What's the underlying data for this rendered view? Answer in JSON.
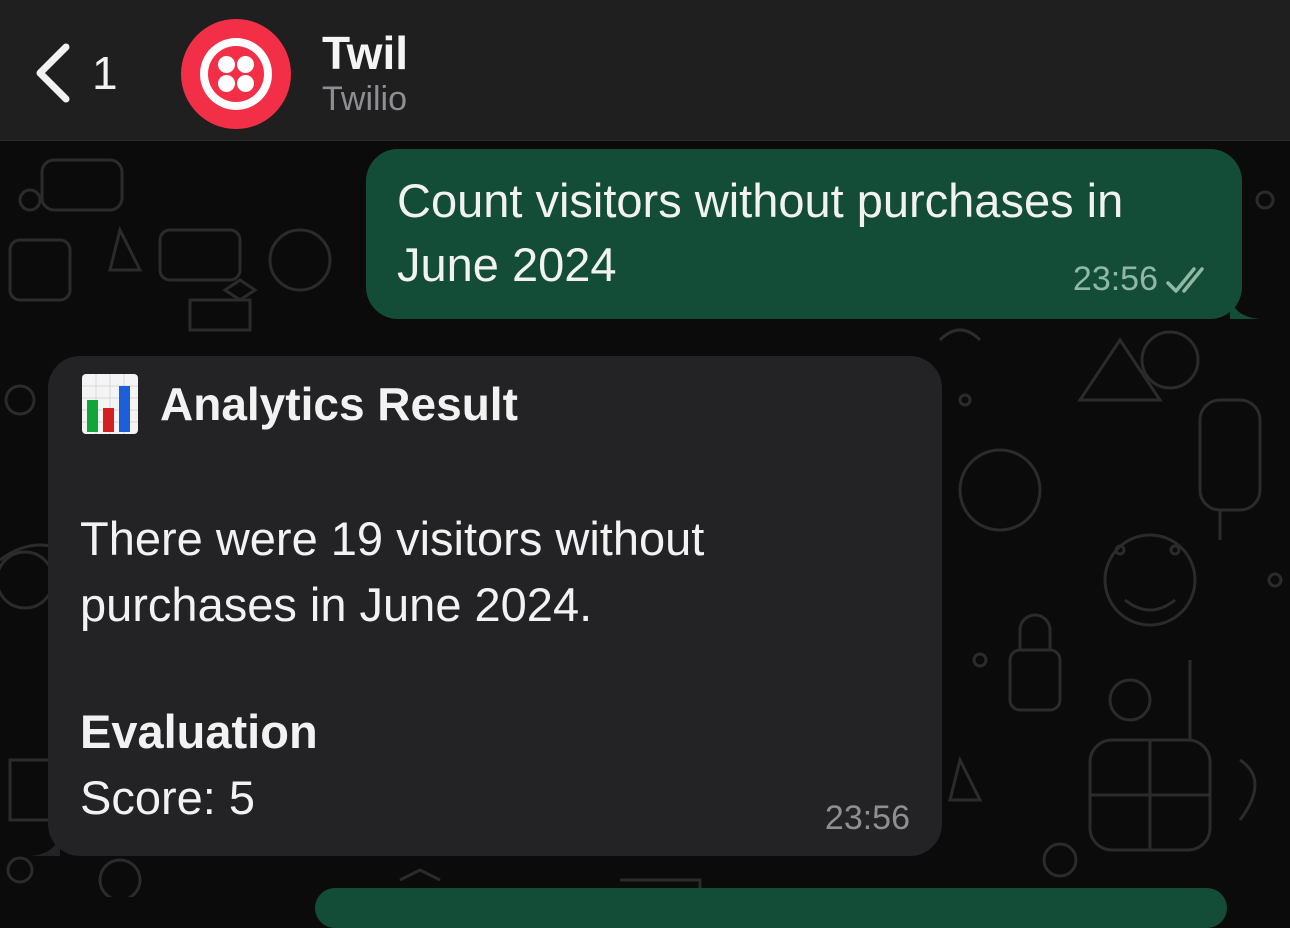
{
  "header": {
    "back_count": "1",
    "contact_name": "Twil",
    "contact_subtitle": "Twilio",
    "avatar_color": "#f22f46"
  },
  "messages": {
    "outgoing": {
      "text": "Count visitors without purchases in June 2024",
      "time": "23:56",
      "status": "read"
    },
    "incoming": {
      "icon": "bar-chart-emoji",
      "title": "Analytics Result",
      "body": "There were 19 visitors without purchases in June 2024.",
      "evaluation_title": "Evaluation",
      "evaluation_score": "Score: 5",
      "time": "23:56"
    }
  },
  "colors": {
    "outgoing_bubble": "#144d37",
    "incoming_bubble": "#232325",
    "header_bg": "#1f1f1f"
  }
}
